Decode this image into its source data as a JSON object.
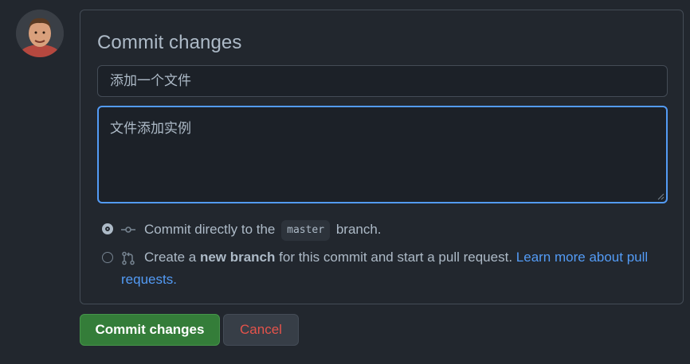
{
  "panel": {
    "title": "Commit changes",
    "summary_value": "添加一个文件",
    "description_value": "文件添加实例"
  },
  "options": {
    "direct": {
      "selected": true,
      "text_before": "Commit directly to the",
      "branch": "master",
      "text_after": "branch."
    },
    "new_branch": {
      "selected": false,
      "text_before": "Create a",
      "bold": "new branch",
      "text_after": "for this commit and start a pull request.",
      "link_line1": "Learn more about pull",
      "link_line2": "requests."
    }
  },
  "buttons": {
    "commit": "Commit changes",
    "cancel": "Cancel"
  },
  "colors": {
    "background": "#22272e",
    "accent_blue": "#539bf5",
    "commit_green": "#347d39",
    "cancel_red": "#e5534b"
  },
  "icons": {
    "direct": "git-commit-icon",
    "new_branch": "git-pull-request-icon"
  }
}
